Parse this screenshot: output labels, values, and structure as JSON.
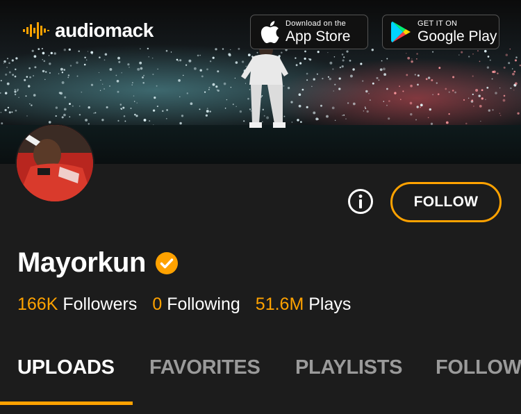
{
  "header": {
    "logo_text": "audiomack",
    "app_store": {
      "small": "Download on the",
      "big": "App Store"
    },
    "google_play": {
      "small": "GET IT ON",
      "big": "Google Play"
    }
  },
  "profile": {
    "name": "Mayorkun",
    "follow_label": "FOLLOW",
    "stats": [
      {
        "value": "166K",
        "label": "Followers"
      },
      {
        "value": "0",
        "label": "Following"
      },
      {
        "value": "51.6M",
        "label": "Plays"
      }
    ]
  },
  "tabs": [
    {
      "label": "UPLOADS",
      "active": true
    },
    {
      "label": "FAVORITES",
      "active": false
    },
    {
      "label": "PLAYLISTS",
      "active": false
    },
    {
      "label": "FOLLOWING",
      "active": false
    }
  ],
  "colors": {
    "accent": "#ffa200",
    "background": "#1c1c1c",
    "inactive_tab": "#9a9a9a"
  },
  "icons": [
    "audiomack-logo-icon",
    "apple-icon",
    "google-play-icon",
    "info-icon",
    "verified-icon"
  ]
}
